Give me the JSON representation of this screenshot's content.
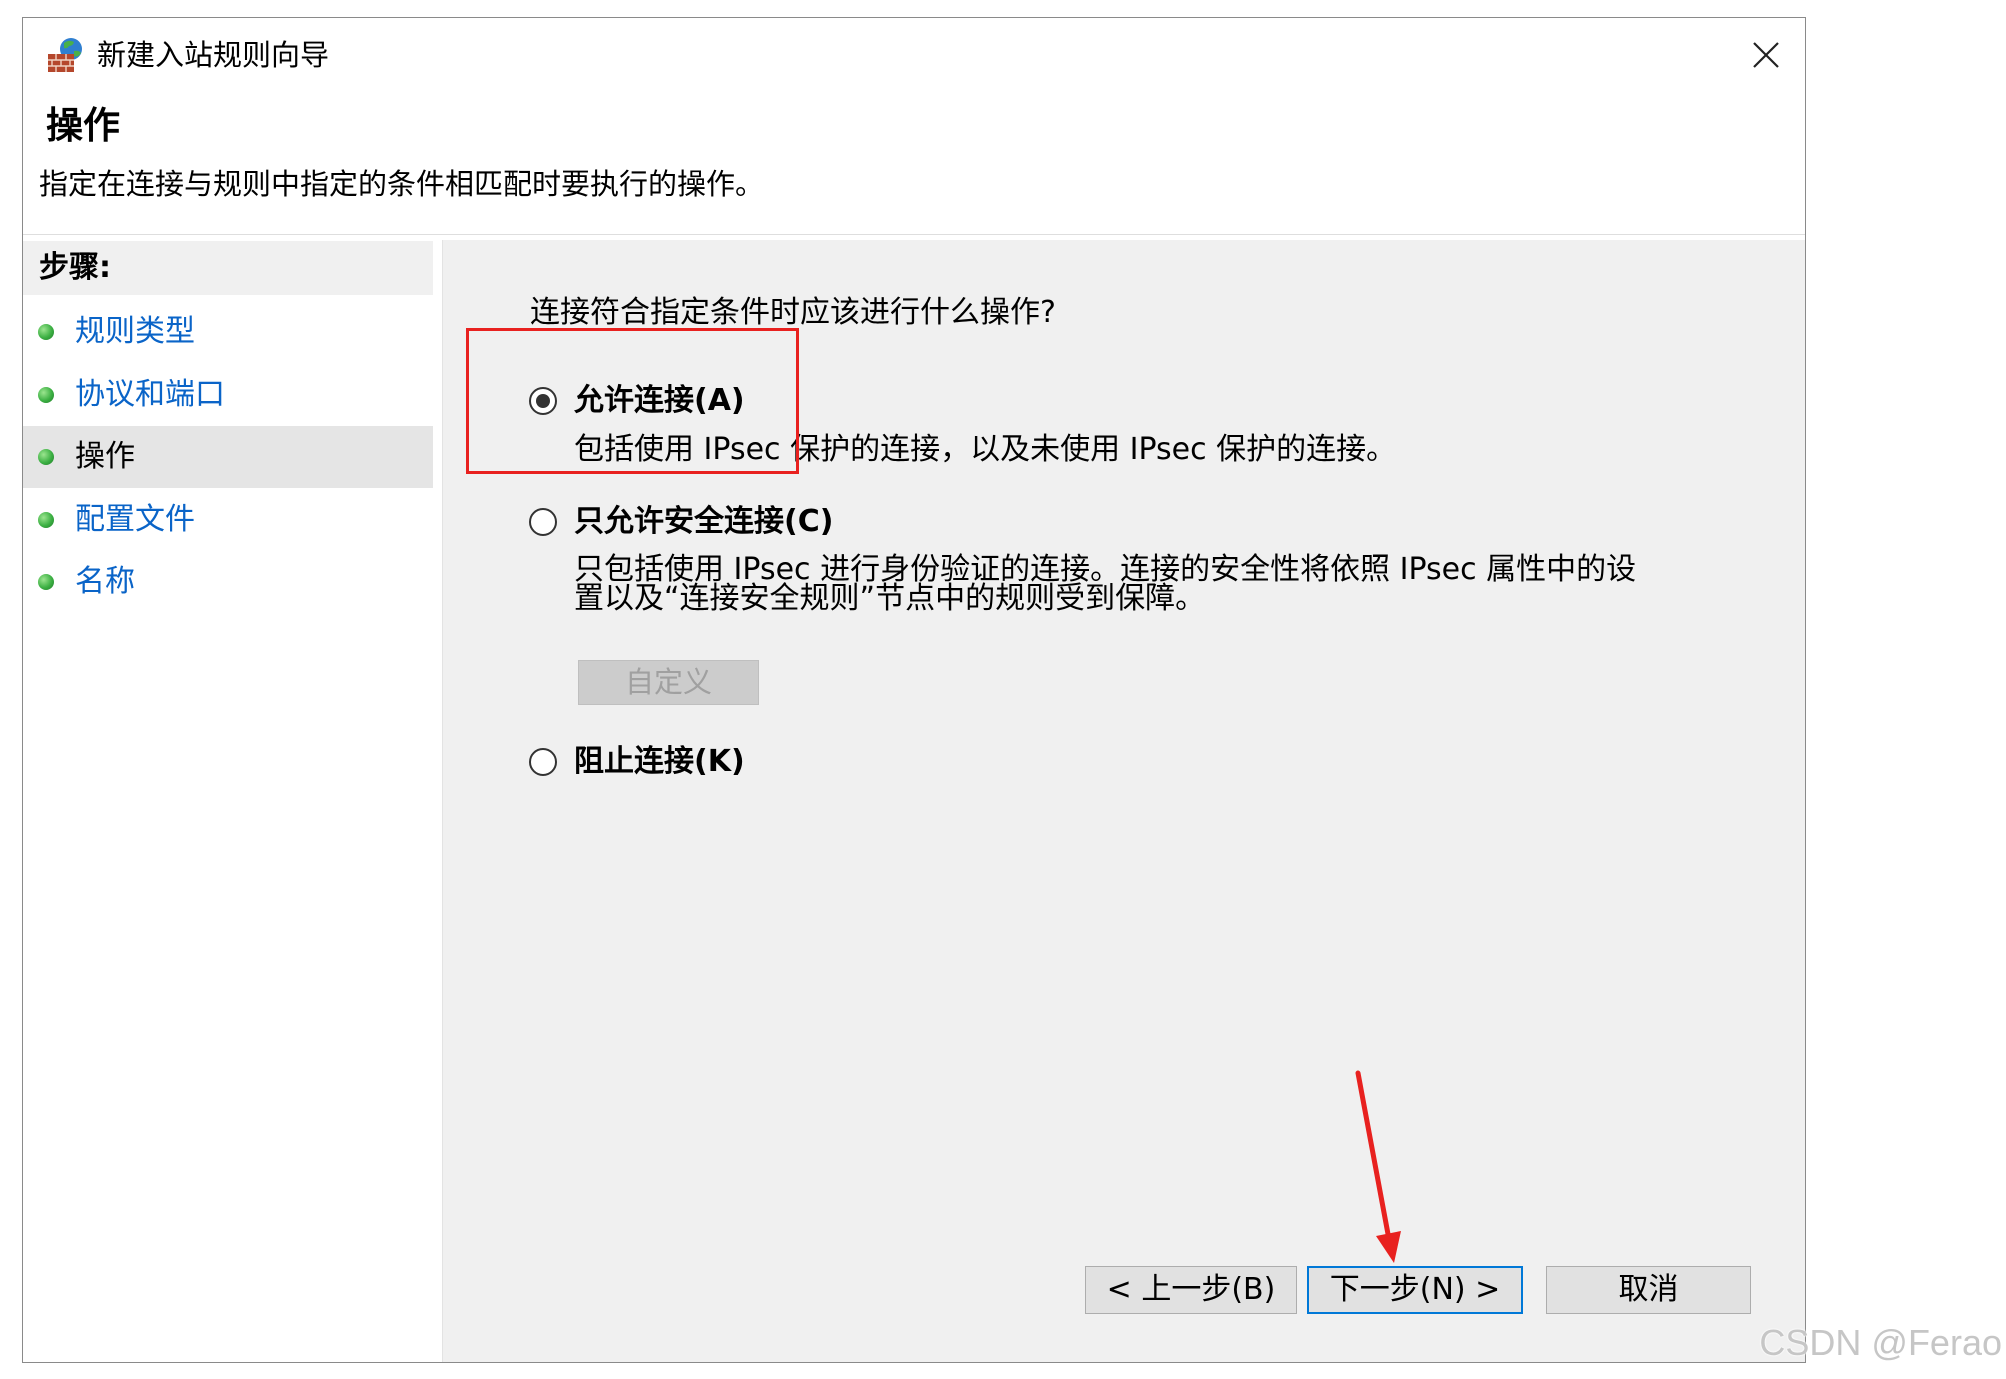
{
  "window": {
    "title": "新建入站规则向导"
  },
  "icons": {
    "title": "firewall-icon",
    "close": "close-icon",
    "step_bullet": "green-dot-icon"
  },
  "header": {
    "title": "操作",
    "description": "指定在连接与规则中指定的条件相匹配时要执行的操作。"
  },
  "steps": {
    "heading": "步骤:",
    "items": [
      {
        "label": "规则类型",
        "current": false
      },
      {
        "label": "协议和端口",
        "current": false
      },
      {
        "label": "操作",
        "current": true
      },
      {
        "label": "配置文件",
        "current": false
      },
      {
        "label": "名称",
        "current": false
      }
    ]
  },
  "main": {
    "question": "连接符合指定条件时应该进行什么操作?",
    "options": [
      {
        "label": "允许连接(A)",
        "selected": true,
        "description_lines": [
          "包括使用 IPsec 保护的连接，以及未使用 IPsec 保护的连接。"
        ]
      },
      {
        "label": "只允许安全连接(C)",
        "selected": false,
        "description_lines": [
          "只包括使用 IPsec 进行身份验证的连接。连接的安全性将依照 IPsec 属性中的设",
          "置以及“连接安全规则”节点中的规则受到保障。"
        ],
        "custom_button": {
          "label": "自定义",
          "enabled": false
        }
      },
      {
        "label": "阻止连接(K)",
        "selected": false
      }
    ]
  },
  "footer": {
    "back_label": "< 上一步(B)",
    "next_label": "下一步(N) >",
    "cancel_label": "取消"
  },
  "watermark": "CSDN @Ferao",
  "colors": {
    "link": "#0a64c8",
    "panel_bg": "#f0f0f0",
    "annotation_red": "#e8211f",
    "focus_border": "#0078d7",
    "step_bullet": "#3cb043"
  }
}
